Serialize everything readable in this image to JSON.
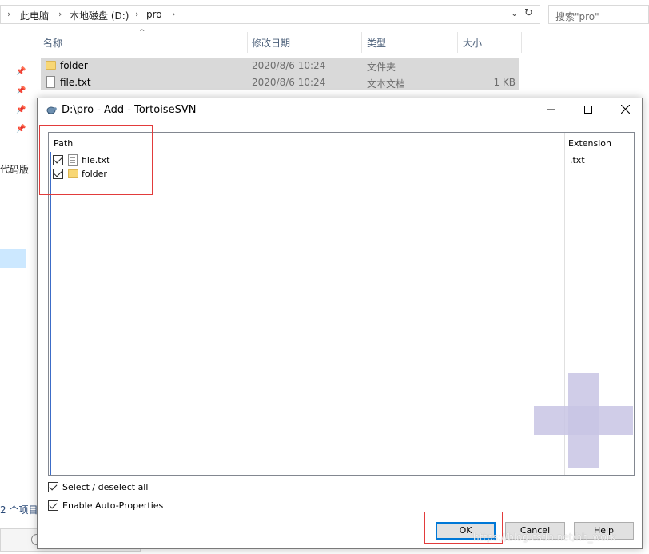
{
  "explorer": {
    "breadcrumb": [
      "此电脑",
      "本地磁盘 (D:)",
      "pro"
    ],
    "search_placeholder": "搜索\"pro\"",
    "columns": {
      "name": "名称",
      "date": "修改日期",
      "type": "类型",
      "size": "大小"
    },
    "files": [
      {
        "name": "folder",
        "date": "2020/8/6 10:24",
        "type": "文件夹",
        "size": "",
        "icon": "folder-icon"
      },
      {
        "name": "file.txt",
        "date": "2020/8/6 10:24",
        "type": "文本文档",
        "size": "1 KB",
        "icon": "text-file-icon"
      }
    ],
    "sidebar_text": "代码版",
    "status_count": "2 个项目"
  },
  "dialog": {
    "title": "D:\\pro - Add - TortoiseSVN",
    "list": {
      "headers": {
        "path": "Path",
        "extension": "Extension"
      },
      "items": [
        {
          "name": "file.txt",
          "extension": ".txt",
          "checked": true,
          "icon": "text-file-icon"
        },
        {
          "name": "folder",
          "extension": "",
          "checked": true,
          "icon": "folder-icon"
        }
      ]
    },
    "options": {
      "select_all": "Select / deselect all",
      "auto_properties": "Enable Auto-Properties"
    },
    "buttons": {
      "ok": "OK",
      "cancel": "Cancel",
      "help": "Help"
    },
    "watermark": "https://blog.csdn.net/hh_work"
  },
  "colors": {
    "highlight_red": "#e23b3b",
    "accent_blue": "#0078d7",
    "plus_lavender": "#c8c4e4"
  }
}
